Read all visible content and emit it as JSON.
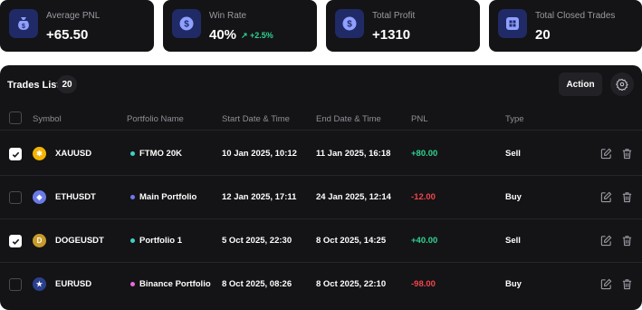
{
  "stats": [
    {
      "label": "Average PNL",
      "value": "+65.50",
      "change": "",
      "icon": "money-bag-icon"
    },
    {
      "label": "Win Rate",
      "value": "40%",
      "change": "↗ +2.5%",
      "icon": "dollar-coin-icon"
    },
    {
      "label": "Total Profit",
      "value": "+1310",
      "change": "",
      "icon": "dollar-coin-icon"
    },
    {
      "label": "Total Closed Trades",
      "value": "20",
      "change": "",
      "icon": "grid-box-icon"
    }
  ],
  "trades": {
    "title": "Trades List",
    "count": "20",
    "action_label": "Action",
    "columns": [
      "Symbol",
      "Portfolio Name",
      "Start Date & Time",
      "End Date & Time",
      "PNL",
      "Type"
    ],
    "rows": [
      {
        "checked": true,
        "symbol": "XAUUSD",
        "coin_color": "#f5b300",
        "coin_glyph": "✱",
        "portfolio": "FTMO 20K",
        "dot_color": "#3ed1c6",
        "start": "10 Jan 2025, 10:12",
        "end": "11 Jan 2025, 16:18",
        "pnl": "+80.00",
        "pnl_color": "#2fd392",
        "type": "Sell"
      },
      {
        "checked": false,
        "symbol": "ETHUSDT",
        "coin_color": "#6a7be8",
        "coin_glyph": "◆",
        "portfolio": "Main Portfolio",
        "dot_color": "#6e78f0",
        "start": "12 Jan 2025, 17:11",
        "end": "24 Jan 2025, 12:14",
        "pnl": "-12.00",
        "pnl_color": "#f0444c",
        "type": "Buy"
      },
      {
        "checked": true,
        "symbol": "DOGEUSDT",
        "coin_color": "#c89a2a",
        "coin_glyph": "D",
        "portfolio": "Portfolio 1",
        "dot_color": "#3ed1c6",
        "start": "5 Oct 2025, 22:30",
        "end": "8 Oct 2025, 14:25",
        "pnl": "+40.00",
        "pnl_color": "#2fd392",
        "type": "Sell"
      },
      {
        "checked": false,
        "symbol": "EURUSD",
        "coin_color": "#2b3f8f",
        "coin_glyph": "★",
        "portfolio": "Binance Portfolio",
        "dot_color": "#e86ad8",
        "start": "8 Oct 2025, 08:26",
        "end": "8 Oct 2025, 22:10",
        "pnl": "-98.00",
        "pnl_color": "#f0444c",
        "type": "Buy"
      }
    ]
  }
}
